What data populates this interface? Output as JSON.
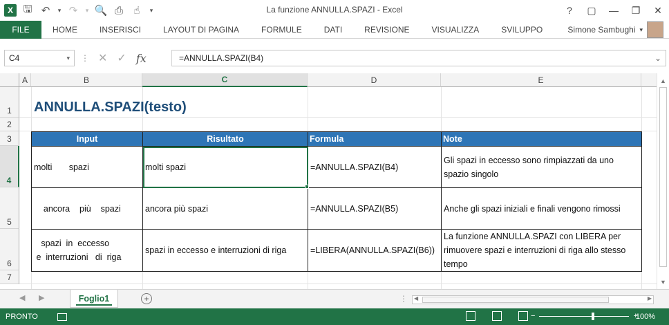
{
  "window": {
    "title": "La funzione ANNULLA.SPAZI - Excel",
    "help": "?",
    "controls": [
      "▢",
      "—",
      "❐",
      "✕"
    ]
  },
  "ribbon": {
    "file": "FILE",
    "tabs": [
      "HOME",
      "INSERISCI",
      "LAYOUT DI PAGINA",
      "FORMULE",
      "DATI",
      "REVISIONE",
      "VISUALIZZA",
      "SVILUPPO"
    ],
    "user": "Simone Sambughi"
  },
  "formula_bar": {
    "name_box": "C4",
    "formula": "=ANNULLA.SPAZI(B4)",
    "fx": "fx"
  },
  "columns": [
    "A",
    "B",
    "C",
    "D",
    "E"
  ],
  "selected_column": "C",
  "rows": [
    "1",
    "2",
    "3",
    "4",
    "5",
    "6",
    "7"
  ],
  "selected_row": "4",
  "sheet": {
    "title": "ANNULLA.SPAZI(testo)",
    "headers": [
      "Input",
      "Risultato",
      "Formula",
      "Note"
    ],
    "data": [
      {
        "input": "molti       spazi",
        "result": "molti spazi",
        "formula": "=ANNULLA.SPAZI(B4)",
        "note": "Gli spazi in eccesso sono rimpiazzati da uno spazio singolo"
      },
      {
        "input": "    ancora    più    spazi",
        "result": "ancora più spazi",
        "formula": "=ANNULLA.SPAZI(B5)",
        "note": "Anche gli spazi iniziali e finali vengono rimossi"
      },
      {
        "input": "   spazi  in  eccesso\n e  interruzioni   di  riga",
        "result": "spazi in eccesso e interruzioni di riga",
        "formula": "=LIBERA(ANNULLA.SPAZI(B6))",
        "note": "La funzione ANNULLA.SPAZI con LIBERA per rimuovere spazi e interruzioni di riga allo stesso tempo"
      }
    ]
  },
  "sheet_tabs": {
    "active": "Foglio1",
    "add": "+"
  },
  "status": {
    "ready": "PRONTO",
    "zoom_minus": "−",
    "zoom_plus": "+",
    "zoom": "100%"
  }
}
